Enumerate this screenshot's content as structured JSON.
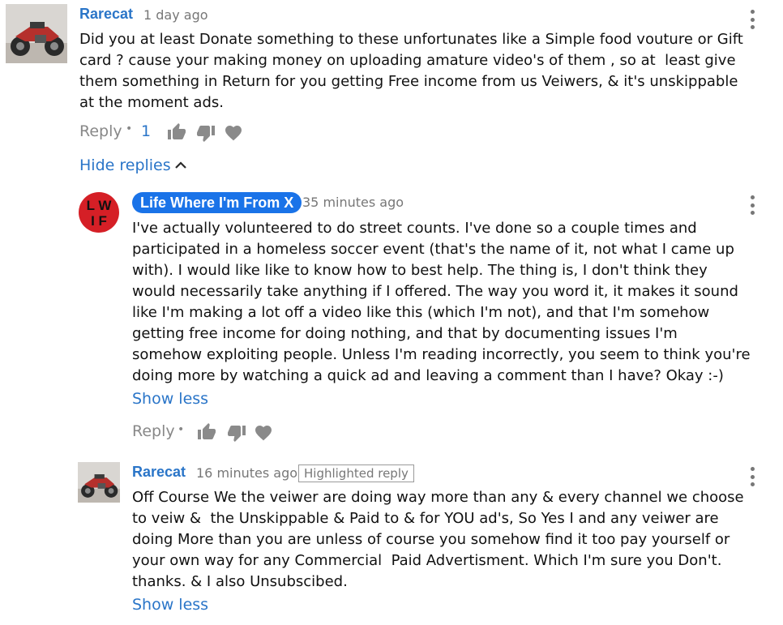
{
  "comment": {
    "author": "Rarecat",
    "time": "1 day ago",
    "lines": [
      "Did you at least Donate something to these unfortunates like a Simple food vouture or Gift",
      "card ? cause your making money on uploading amature video's of them , so at  least give",
      "them something in Return for you getting Free income from us Veiwers, & it's unskippable",
      "at the moment ads."
    ],
    "reply_label": "Reply",
    "separator": "•",
    "like_count": "1",
    "hide_replies_label": "Hide replies",
    "icons": [
      "thumbs-up-icon",
      "thumbs-down-icon",
      "heart-icon",
      "chevron-up-icon",
      "more-vert-icon"
    ]
  },
  "reply1": {
    "author": "Life Where I'm From X",
    "avatar_text": "LWIF",
    "time": "35 minutes ago",
    "lines": [
      "I've actually volunteered to do street counts. I've done so a couple times and",
      "participated in a homeless soccer event (that's the name of it, not what I came up",
      "with). I would like like to know how to best help. The thing is, I don't think they",
      "would necessarily take anything if I offered. The way you word it, it makes it sound",
      "like I'm making a lot off a video like this (which I'm not), and that I'm somehow",
      "getting free income for doing nothing, and that by documenting issues I'm",
      "somehow exploiting people. Unless I'm reading incorrectly, you seem to think you're",
      "doing more by watching a quick ad and leaving a comment than I have? Okay :-)"
    ],
    "show_less_label": "Show less",
    "reply_label": "Reply",
    "separator": "•",
    "accent_color": "#1a73e8"
  },
  "reply2": {
    "author": "Rarecat",
    "time": "16 minutes ago",
    "highlight_label": "Highlighted reply",
    "lines": [
      "Off Course We the veiwer are doing way more than any & every channel we choose",
      "to veiw &  the Unskippable & Paid to & for YOU ad's, So Yes I and any veiwer are",
      "doing More than you are unless of course you somehow find it too pay yourself or",
      "your own way for any Commercial  Paid Advertisment. Which I'm sure you Don't.",
      "thanks. & I also Unsubscibed."
    ],
    "show_less_label": "Show less"
  }
}
